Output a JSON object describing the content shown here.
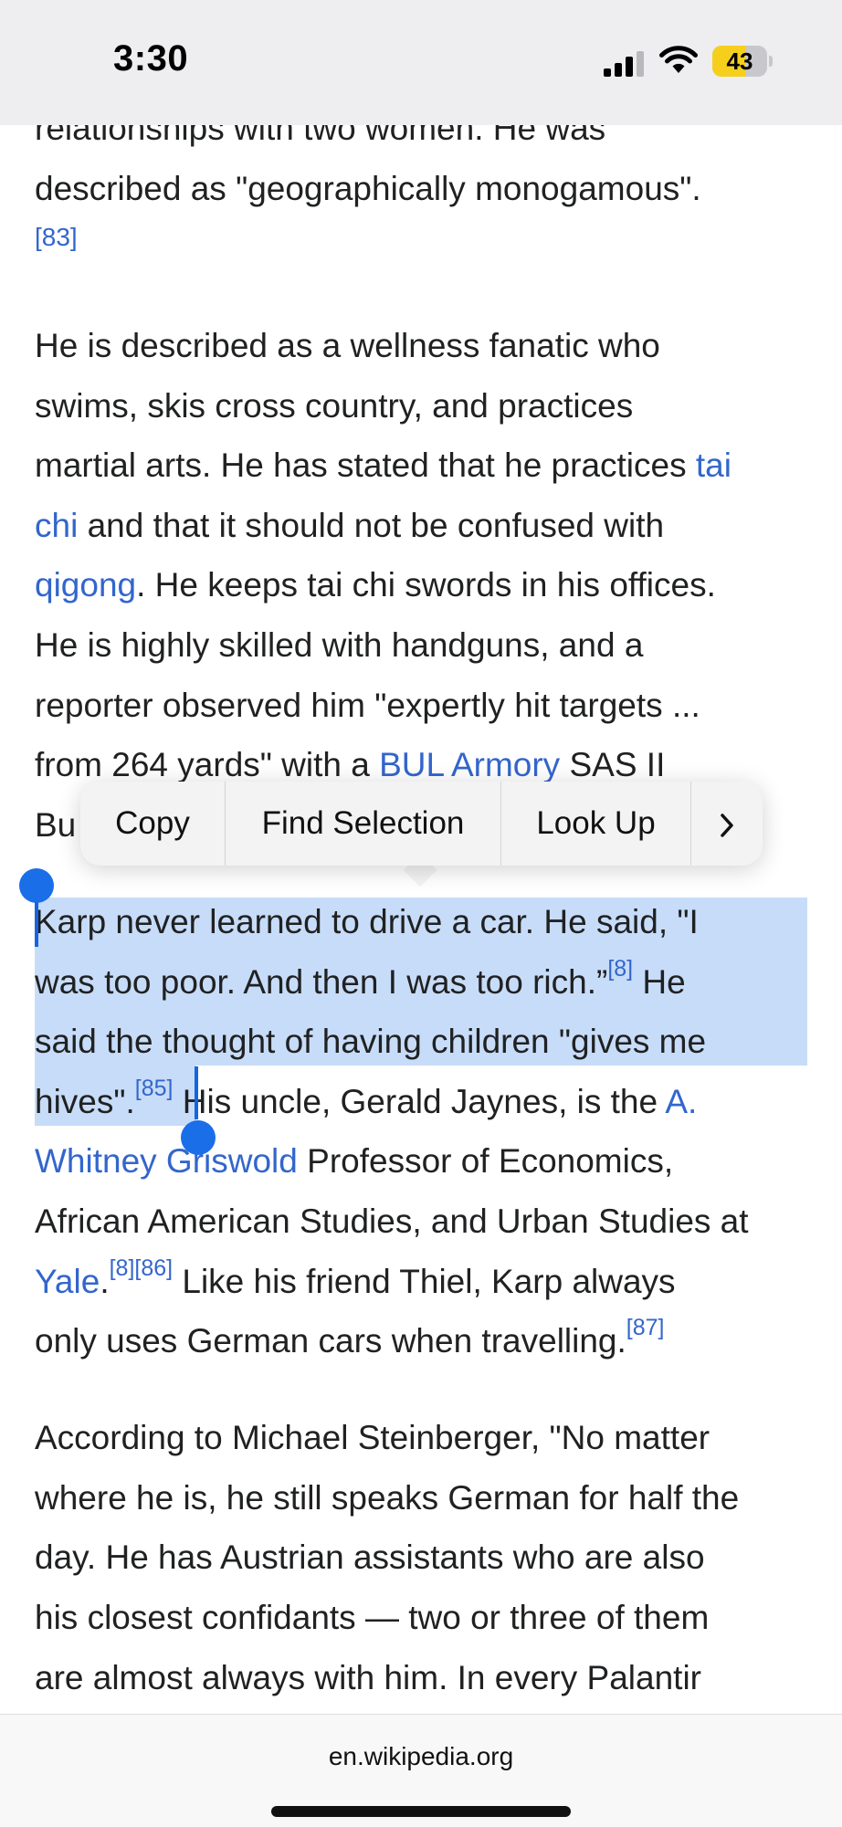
{
  "status_bar": {
    "time": "3:30",
    "battery": "43",
    "icons": [
      "cellular-signal-icon",
      "wifi-icon",
      "battery-icon"
    ]
  },
  "article": {
    "partial_line": "relationships with two women. He was",
    "p1": {
      "line2": "described as \"geographically monogamous\".",
      "cite_83": "[83]"
    },
    "p2": {
      "l1": "He is described as a wellness fanatic who",
      "l2": "swims, skis cross country, and practices",
      "l3_text": "martial arts. He has stated that he practices ",
      "l3_link": "tai",
      "l4_link": "chi",
      "l4_text": " and that it should not be confused with",
      "l5_link": "qigong",
      "l5_text": ". He keeps tai chi swords in his offices.",
      "l6": "He is highly skilled with handguns, and a",
      "l7": "reporter observed him \"expertly hit targets ...",
      "l8_text": "from 264 yards\" with a ",
      "l8_link": "BUL Armory",
      "l8_after": " SAS II",
      "l9": "Bu"
    },
    "p3": {
      "l1": "Karp never learned to drive a car. He said, \"I",
      "l2_text": "was too poor. And then I was too rich.”",
      "cite_8a": "[8]",
      "l2_after": " He",
      "l3": "said the thought of having children \"gives me",
      "l4_text": "hives\".",
      "cite_85": "[85]",
      "l4_after": " His uncle, Gerald Jaynes, is the ",
      "l4_link": "A.",
      "l5_link": "Whitney Griswold",
      "l5_text": " Professor of Economics,",
      "l6": "African American Studies, and Urban Studies at",
      "l7_link": "Yale",
      "l7_dot": ".",
      "cite_8b": "[8]",
      "cite_86": "[86]",
      "l7_text": " Like his friend Thiel, Karp always",
      "l8_text": "only uses German cars when travelling.",
      "cite_87": "[87]"
    },
    "p4": {
      "l1": "According to Michael Steinberger, \"No matter",
      "l2": "where he is, he still speaks German for half the",
      "l3": "day. He has Austrian assistants who are also",
      "l4": "his closest confidants — two or three of them",
      "l5": "are almost always with him. In every Palantir"
    }
  },
  "edit_menu": {
    "copy": "Copy",
    "find_selection": "Find Selection",
    "look_up": "Look Up",
    "more_icon": "chevron-right-icon"
  },
  "url_bar": {
    "url": "en.wikipedia.org"
  }
}
